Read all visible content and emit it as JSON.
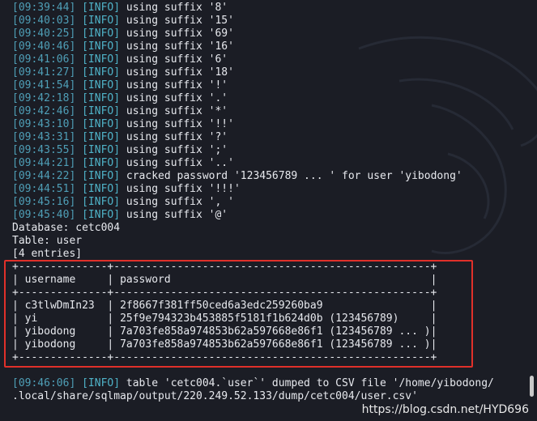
{
  "log_lines": [
    {
      "ts": "[09:39:44]",
      "tag": "[INFO]",
      "msg": "using suffix '8'"
    },
    {
      "ts": "[09:40:03]",
      "tag": "[INFO]",
      "msg": "using suffix '15'"
    },
    {
      "ts": "[09:40:25]",
      "tag": "[INFO]",
      "msg": "using suffix '69'"
    },
    {
      "ts": "[09:40:46]",
      "tag": "[INFO]",
      "msg": "using suffix '16'"
    },
    {
      "ts": "[09:41:06]",
      "tag": "[INFO]",
      "msg": "using suffix '6'"
    },
    {
      "ts": "[09:41:27]",
      "tag": "[INFO]",
      "msg": "using suffix '18'"
    },
    {
      "ts": "[09:41:54]",
      "tag": "[INFO]",
      "msg": "using suffix '!'"
    },
    {
      "ts": "[09:42:18]",
      "tag": "[INFO]",
      "msg": "using suffix '.'"
    },
    {
      "ts": "[09:42:46]",
      "tag": "[INFO]",
      "msg": "using suffix '*'"
    },
    {
      "ts": "[09:43:10]",
      "tag": "[INFO]",
      "msg": "using suffix '!!'"
    },
    {
      "ts": "[09:43:31]",
      "tag": "[INFO]",
      "msg": "using suffix '?'"
    },
    {
      "ts": "[09:43:55]",
      "tag": "[INFO]",
      "msg": "using suffix ';'"
    },
    {
      "ts": "[09:44:21]",
      "tag": "[INFO]",
      "msg": "using suffix '..'"
    },
    {
      "ts": "[09:44:22]",
      "tag": "[INFO]",
      "msg": "cracked password '123456789 ... ' for user 'yibodong'"
    },
    {
      "ts": "[09:44:51]",
      "tag": "[INFO]",
      "msg": "using suffix '!!!'"
    },
    {
      "ts": "[09:45:16]",
      "tag": "[INFO]",
      "msg": "using suffix ', '"
    },
    {
      "ts": "[09:45:40]",
      "tag": "[INFO]",
      "msg": "using suffix '@'"
    }
  ],
  "db_info": {
    "database": "Database: cetc004",
    "table": "Table: user",
    "entries": "[4 entries]"
  },
  "table": {
    "border_top": "+--------------+--------------------------------------------------+",
    "header_sep": "+--------------+--------------------------------------------------+",
    "border_bottom": "+--------------+--------------------------------------------------+",
    "columns": [
      "username",
      "password"
    ],
    "rows": [
      {
        "username": "c3tlwDmIn23",
        "password": "2f8667f381ff50ced6a3edc259260ba9"
      },
      {
        "username": "yi",
        "password": "25f9e794323b453885f5181f1b624d0b (123456789)"
      },
      {
        "username": "yibodong",
        "password": "7a703fe858a974853b62a597668e86f1 (123456789 ... )"
      },
      {
        "username": "yibodong",
        "password": "7a703fe858a974853b62a597668e86f1 (123456789 ... )"
      }
    ]
  },
  "final_log": {
    "ts": "[09:46:06]",
    "tag": "[INFO]",
    "msg_line1": "table 'cetc004.`user`' dumped to CSV file '/home/yibodong/",
    "msg_line2": ".local/share/sqlmap/output/220.249.52.133/dump/cetc004/user.csv'"
  },
  "watermark_text": "https://blog.csdn.net/HYD696",
  "colors": {
    "background": "#1b1d25",
    "timestamp": "#4f9fb7",
    "text": "#e7e9ee",
    "highlight_border": "#e0302a"
  }
}
